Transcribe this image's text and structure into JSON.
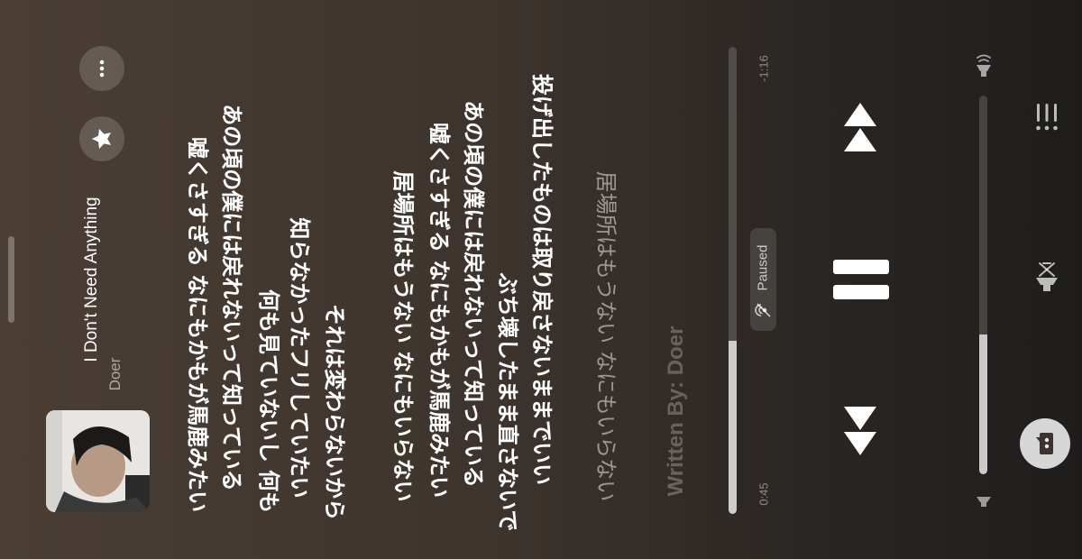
{
  "now_playing": {
    "title": "I Don't Need Anything",
    "artist": "Doer"
  },
  "lyrics": {
    "stanza1": [
      "嘘くさすぎる なにもかもが馬鹿みたい",
      "あの頃の僕には戻れないって知っている",
      "何も見ていないし 何も",
      "知らなかったフリしていたい",
      "それは変わらないから"
    ],
    "stanza2": [
      "居場所はもうない なにもいらない",
      "嘘くさすぎる なにもかもが馬鹿みたい",
      "あの頃の僕には戻れないって知っている",
      "ぶち壊したまま直さないで",
      "投げ出したものは取り戻さないままでいい"
    ],
    "upcoming": "居場所はもうない なにもいらない",
    "credits": "Written By: Doer"
  },
  "playback": {
    "state_label": "Paused",
    "elapsed": "0:45",
    "remaining": "-1:16",
    "progress": 0.37,
    "volume": 0.37
  },
  "icons": {
    "more": "ellipsis-icon",
    "favorite": "star-icon",
    "paused_badge": "no-broadcast-icon",
    "previous": "backward-icon",
    "pause": "pause-icon",
    "next": "forward-icon",
    "volume_low": "speaker-low-icon",
    "volume_high": "speaker-high-icon",
    "lyrics": "lyrics-quote-icon",
    "airplay": "airplay-icon",
    "queue": "queue-list-icon"
  },
  "colors": {
    "background_start": "#4a3e35",
    "background_end": "#1f1d1c",
    "accent": "#ffffff"
  }
}
